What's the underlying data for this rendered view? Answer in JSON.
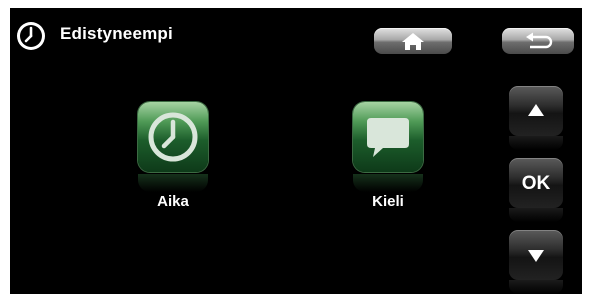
{
  "header": {
    "title": "Edistyneempi",
    "icon": "clock-icon"
  },
  "toolbar": {
    "home_icon": "home-icon",
    "back_icon": "back-arrow-icon"
  },
  "tiles": [
    {
      "label": "Aika",
      "icon": "clock-icon"
    },
    {
      "label": "Kieli",
      "icon": "speech-bubble-icon"
    }
  ],
  "navigation": {
    "up_icon": "arrow-up-icon",
    "ok_label": "OK",
    "down_icon": "arrow-down-icon"
  },
  "colors": {
    "background": "#000000",
    "tile_green": "#1c5d2b",
    "text": "#ffffff"
  }
}
